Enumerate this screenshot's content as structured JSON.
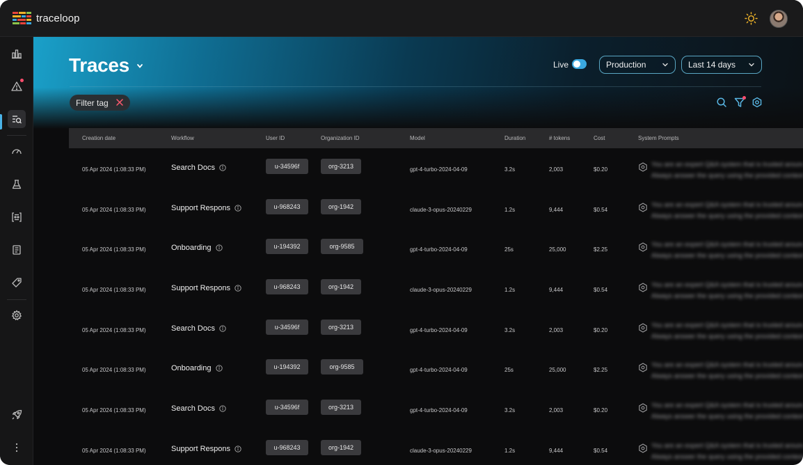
{
  "app": {
    "name": "traceloop"
  },
  "page": {
    "title": "Traces"
  },
  "controls": {
    "live_label": "Live",
    "live_on": true,
    "environment": "Production",
    "date_range": "Last 14 days",
    "filter_chip": "Filter tag"
  },
  "table": {
    "columns": [
      "Creation date",
      "Workflow",
      "User ID",
      "Organization ID",
      "Model",
      "Duration",
      "# tokens",
      "Cost",
      "System Prompts"
    ],
    "prompt_line1": "You are an expert Q&A system that is trusted around the world.",
    "prompt_line2": "Always answer the query using the provided context information.",
    "rows": [
      {
        "date": "05 Apr 2024 (1:08:33 PM)",
        "workflow": "Search Docs",
        "user": "u-34596f",
        "org": "org-3213",
        "model": "gpt-4-turbo-2024-04-09",
        "duration": "3.2s",
        "tokens": "2,003",
        "cost": "$0.20"
      },
      {
        "date": "05 Apr 2024 (1:08:33 PM)",
        "workflow": "Support Respons",
        "user": "u-968243",
        "org": "org-1942",
        "model": "claude-3-opus-20240229",
        "duration": "1.2s",
        "tokens": "9,444",
        "cost": "$0.54"
      },
      {
        "date": "05 Apr 2024 (1:08:33 PM)",
        "workflow": "Onboarding",
        "user": "u-194392",
        "org": "org-9585",
        "model": "gpt-4-turbo-2024-04-09",
        "duration": "25s",
        "tokens": "25,000",
        "cost": "$2.25"
      },
      {
        "date": "05 Apr 2024 (1:08:33 PM)",
        "workflow": "Support Respons",
        "user": "u-968243",
        "org": "org-1942",
        "model": "claude-3-opus-20240229",
        "duration": "1.2s",
        "tokens": "9,444",
        "cost": "$0.54"
      },
      {
        "date": "05 Apr 2024 (1:08:33 PM)",
        "workflow": "Search Docs",
        "user": "u-34596f",
        "org": "org-3213",
        "model": "gpt-4-turbo-2024-04-09",
        "duration": "3.2s",
        "tokens": "2,003",
        "cost": "$0.20"
      },
      {
        "date": "05 Apr 2024 (1:08:33 PM)",
        "workflow": "Onboarding",
        "user": "u-194392",
        "org": "org-9585",
        "model": "gpt-4-turbo-2024-04-09",
        "duration": "25s",
        "tokens": "25,000",
        "cost": "$2.25"
      },
      {
        "date": "05 Apr 2024 (1:08:33 PM)",
        "workflow": "Search Docs",
        "user": "u-34596f",
        "org": "org-3213",
        "model": "gpt-4-turbo-2024-04-09",
        "duration": "3.2s",
        "tokens": "2,003",
        "cost": "$0.20"
      },
      {
        "date": "05 Apr 2024 (1:08:33 PM)",
        "workflow": "Support Respons",
        "user": "u-968243",
        "org": "org-1942",
        "model": "claude-3-opus-20240229",
        "duration": "1.2s",
        "tokens": "9,444",
        "cost": "$0.54"
      }
    ]
  },
  "colors": {
    "accent": "#3aa8e0",
    "alert_dot": "#ff4d6d",
    "chip_close": "#ff5a6e",
    "sun": "#f0b429"
  }
}
